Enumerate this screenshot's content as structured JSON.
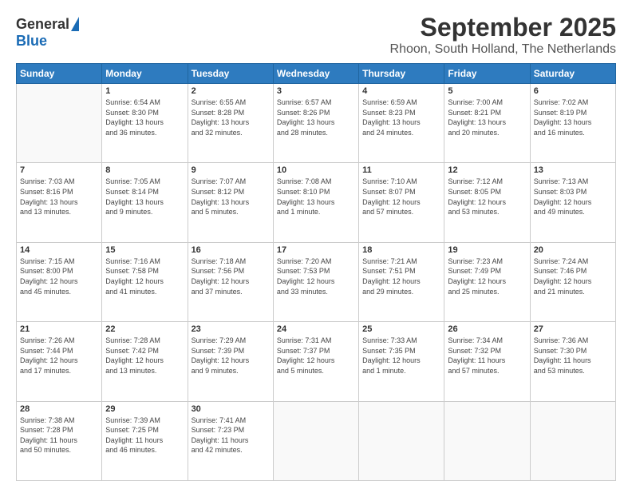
{
  "logo": {
    "general": "General",
    "blue": "Blue"
  },
  "title": "September 2025",
  "location": "Rhoon, South Holland, The Netherlands",
  "days_of_week": [
    "Sunday",
    "Monday",
    "Tuesday",
    "Wednesday",
    "Thursday",
    "Friday",
    "Saturday"
  ],
  "weeks": [
    [
      {
        "day": "",
        "info": ""
      },
      {
        "day": "1",
        "info": "Sunrise: 6:54 AM\nSunset: 8:30 PM\nDaylight: 13 hours\nand 36 minutes."
      },
      {
        "day": "2",
        "info": "Sunrise: 6:55 AM\nSunset: 8:28 PM\nDaylight: 13 hours\nand 32 minutes."
      },
      {
        "day": "3",
        "info": "Sunrise: 6:57 AM\nSunset: 8:26 PM\nDaylight: 13 hours\nand 28 minutes."
      },
      {
        "day": "4",
        "info": "Sunrise: 6:59 AM\nSunset: 8:23 PM\nDaylight: 13 hours\nand 24 minutes."
      },
      {
        "day": "5",
        "info": "Sunrise: 7:00 AM\nSunset: 8:21 PM\nDaylight: 13 hours\nand 20 minutes."
      },
      {
        "day": "6",
        "info": "Sunrise: 7:02 AM\nSunset: 8:19 PM\nDaylight: 13 hours\nand 16 minutes."
      }
    ],
    [
      {
        "day": "7",
        "info": "Sunrise: 7:03 AM\nSunset: 8:16 PM\nDaylight: 13 hours\nand 13 minutes."
      },
      {
        "day": "8",
        "info": "Sunrise: 7:05 AM\nSunset: 8:14 PM\nDaylight: 13 hours\nand 9 minutes."
      },
      {
        "day": "9",
        "info": "Sunrise: 7:07 AM\nSunset: 8:12 PM\nDaylight: 13 hours\nand 5 minutes."
      },
      {
        "day": "10",
        "info": "Sunrise: 7:08 AM\nSunset: 8:10 PM\nDaylight: 13 hours\nand 1 minute."
      },
      {
        "day": "11",
        "info": "Sunrise: 7:10 AM\nSunset: 8:07 PM\nDaylight: 12 hours\nand 57 minutes."
      },
      {
        "day": "12",
        "info": "Sunrise: 7:12 AM\nSunset: 8:05 PM\nDaylight: 12 hours\nand 53 minutes."
      },
      {
        "day": "13",
        "info": "Sunrise: 7:13 AM\nSunset: 8:03 PM\nDaylight: 12 hours\nand 49 minutes."
      }
    ],
    [
      {
        "day": "14",
        "info": "Sunrise: 7:15 AM\nSunset: 8:00 PM\nDaylight: 12 hours\nand 45 minutes."
      },
      {
        "day": "15",
        "info": "Sunrise: 7:16 AM\nSunset: 7:58 PM\nDaylight: 12 hours\nand 41 minutes."
      },
      {
        "day": "16",
        "info": "Sunrise: 7:18 AM\nSunset: 7:56 PM\nDaylight: 12 hours\nand 37 minutes."
      },
      {
        "day": "17",
        "info": "Sunrise: 7:20 AM\nSunset: 7:53 PM\nDaylight: 12 hours\nand 33 minutes."
      },
      {
        "day": "18",
        "info": "Sunrise: 7:21 AM\nSunset: 7:51 PM\nDaylight: 12 hours\nand 29 minutes."
      },
      {
        "day": "19",
        "info": "Sunrise: 7:23 AM\nSunset: 7:49 PM\nDaylight: 12 hours\nand 25 minutes."
      },
      {
        "day": "20",
        "info": "Sunrise: 7:24 AM\nSunset: 7:46 PM\nDaylight: 12 hours\nand 21 minutes."
      }
    ],
    [
      {
        "day": "21",
        "info": "Sunrise: 7:26 AM\nSunset: 7:44 PM\nDaylight: 12 hours\nand 17 minutes."
      },
      {
        "day": "22",
        "info": "Sunrise: 7:28 AM\nSunset: 7:42 PM\nDaylight: 12 hours\nand 13 minutes."
      },
      {
        "day": "23",
        "info": "Sunrise: 7:29 AM\nSunset: 7:39 PM\nDaylight: 12 hours\nand 9 minutes."
      },
      {
        "day": "24",
        "info": "Sunrise: 7:31 AM\nSunset: 7:37 PM\nDaylight: 12 hours\nand 5 minutes."
      },
      {
        "day": "25",
        "info": "Sunrise: 7:33 AM\nSunset: 7:35 PM\nDaylight: 12 hours\nand 1 minute."
      },
      {
        "day": "26",
        "info": "Sunrise: 7:34 AM\nSunset: 7:32 PM\nDaylight: 11 hours\nand 57 minutes."
      },
      {
        "day": "27",
        "info": "Sunrise: 7:36 AM\nSunset: 7:30 PM\nDaylight: 11 hours\nand 53 minutes."
      }
    ],
    [
      {
        "day": "28",
        "info": "Sunrise: 7:38 AM\nSunset: 7:28 PM\nDaylight: 11 hours\nand 50 minutes."
      },
      {
        "day": "29",
        "info": "Sunrise: 7:39 AM\nSunset: 7:25 PM\nDaylight: 11 hours\nand 46 minutes."
      },
      {
        "day": "30",
        "info": "Sunrise: 7:41 AM\nSunset: 7:23 PM\nDaylight: 11 hours\nand 42 minutes."
      },
      {
        "day": "",
        "info": ""
      },
      {
        "day": "",
        "info": ""
      },
      {
        "day": "",
        "info": ""
      },
      {
        "day": "",
        "info": ""
      }
    ]
  ]
}
